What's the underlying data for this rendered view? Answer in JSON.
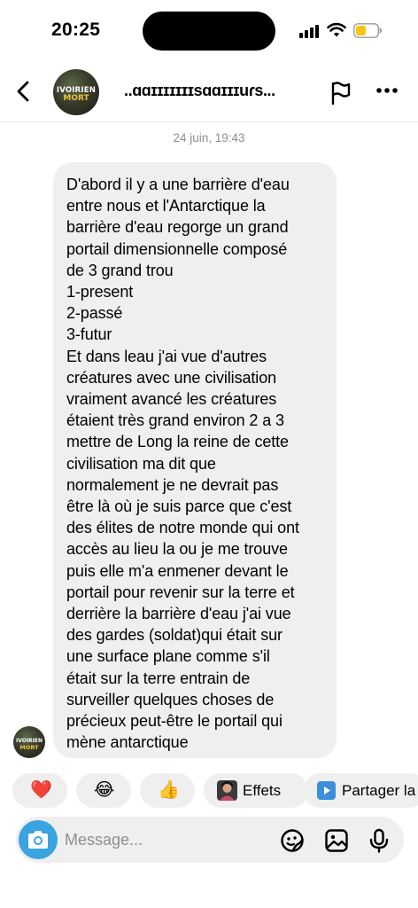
{
  "status_bar": {
    "time": "20:25"
  },
  "header": {
    "title": "..ɑɑɪɪɪɪɪɪɪsɑɑɪɪɪuɾs...",
    "avatar_line1": "IVOIRIEN",
    "avatar_line2": "MORT"
  },
  "conversation": {
    "timestamp": "24 juin, 19:43",
    "message": "D'abord il y a une barrière d'eau\nentre nous et l'Antarctique la\nbarrière d'eau regorge un grand\nportail dimensionnelle composé\nde 3 grand trou\n1-present\n2-passé\n3-futur\nEt dans leau j'ai vue d'autres\ncréatures avec une civilisation\nvraiment avancé les créatures\nétaient très grand environ 2 a 3\nmettre de Long la reine de cette\ncivilisation ma dit que\nnormalement je ne devrait pas\nêtre là où je suis parce que c'est\ndes élites de notre monde qui ont\naccès au lieu la ou je me trouve\npuis elle m'a enmener devant le\nportail pour revenir sur la terre et\nderrière la barrière d'eau j'ai vue\ndes gardes (soldat)qui était sur\nune surface plane comme s'il\nétait sur la terre entrain de\nsurveiller quelques choses de\nprécieux peut-être le portail qui\nmène antarctique"
  },
  "quick_replies": {
    "heart": "❤️",
    "laugh": "😂",
    "thumbs": "👍",
    "effects_label": "Effets",
    "share_label": "Partager la"
  },
  "composer": {
    "placeholder": "Message..."
  },
  "colors": {
    "bubble": "#efefef",
    "camera": "#3aa3e0",
    "avatar_accent": "#e8c341"
  }
}
